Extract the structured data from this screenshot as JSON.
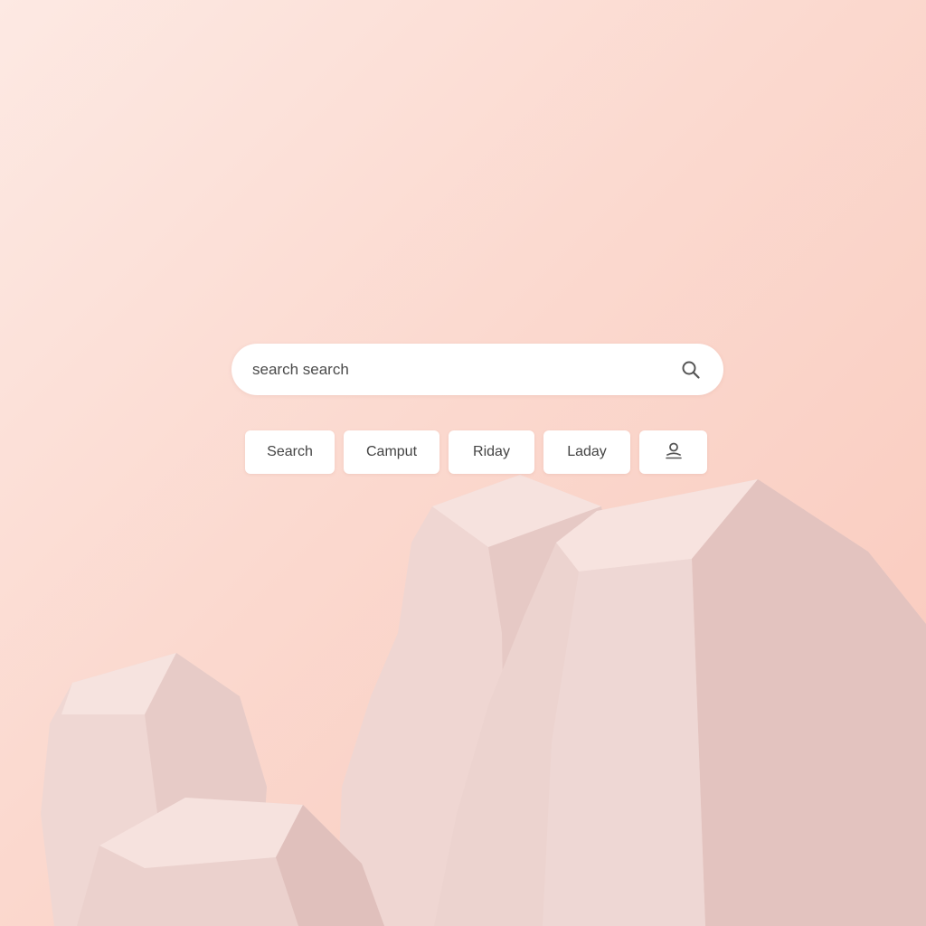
{
  "search": {
    "value": "search search",
    "placeholder": "search search",
    "icon": "search-icon"
  },
  "chips": [
    {
      "label": "Search"
    },
    {
      "label": "Camput"
    },
    {
      "label": "Riday"
    },
    {
      "label": "Laday"
    },
    {
      "icon": "user-icon"
    }
  ],
  "colors": {
    "background_light": "#fde9e3",
    "background_dark": "#f9c8bb",
    "surface": "#ffffff",
    "text": "#444444",
    "icon": "#555555"
  }
}
